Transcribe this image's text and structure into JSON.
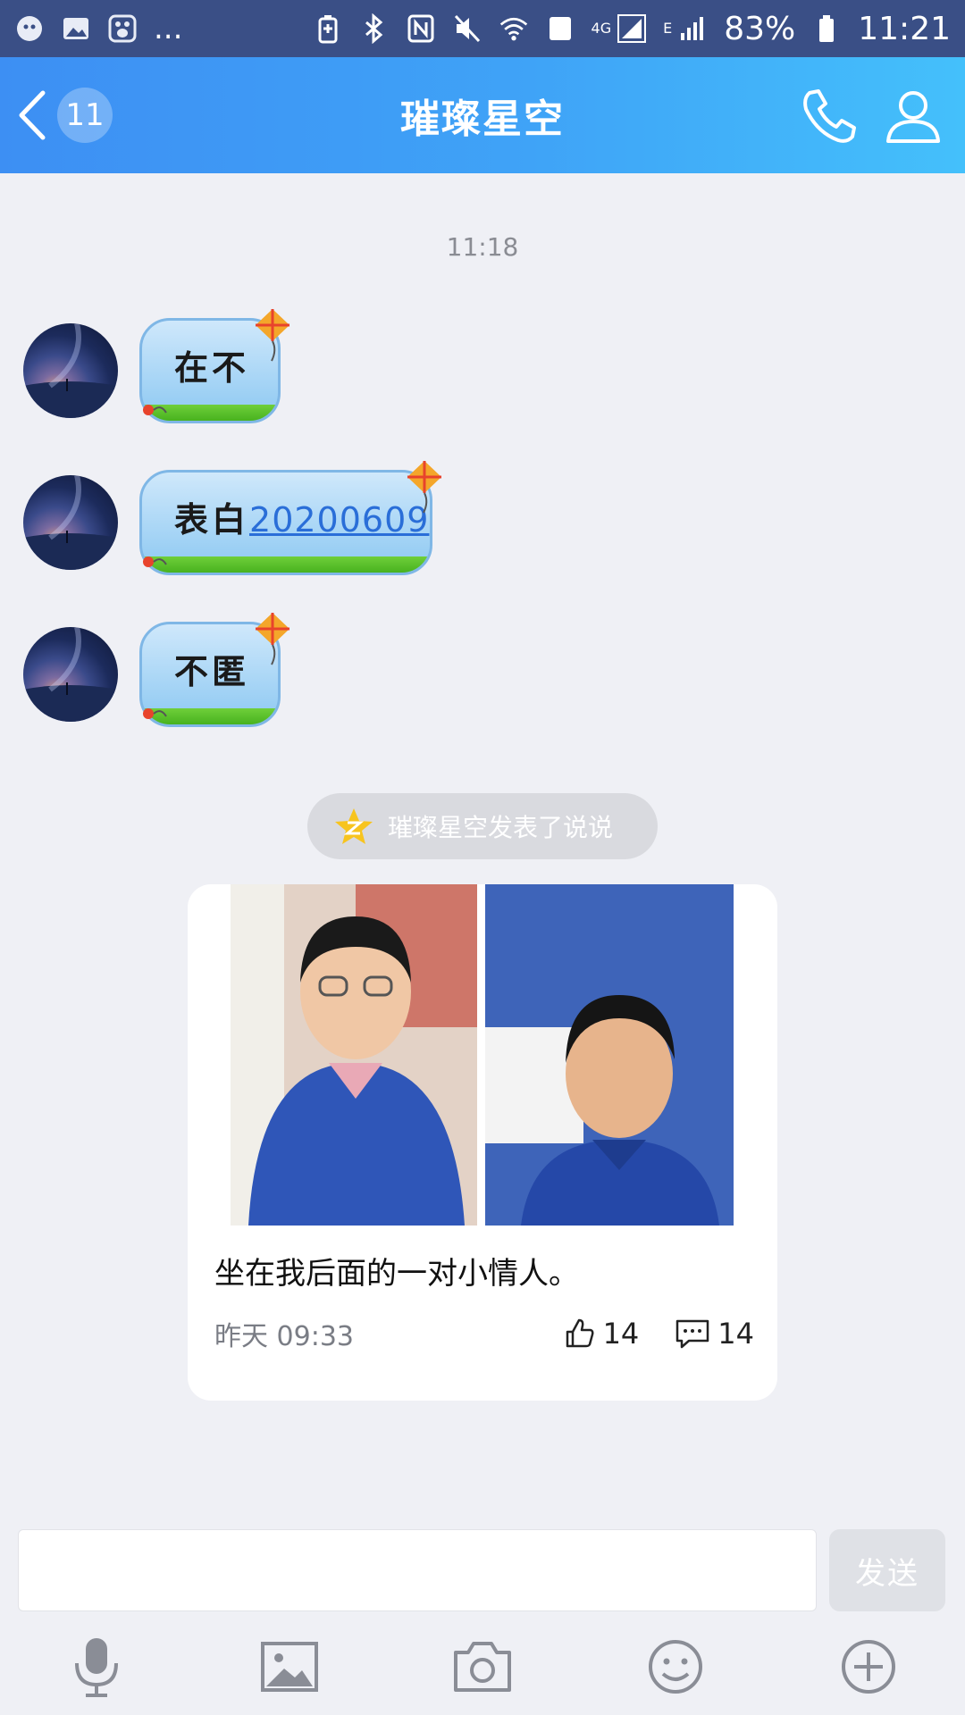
{
  "status_bar": {
    "notification_icons": [
      "cat-app-icon",
      "gallery-icon",
      "baidu-icon"
    ],
    "overflow": "...",
    "sim_badge": "1",
    "network_4g": "4G",
    "network_e": "E",
    "battery": "83%",
    "time": "11:21"
  },
  "header": {
    "back_badge": "11",
    "title": "璀璨星空"
  },
  "chat": {
    "timestamp": "11:18",
    "messages": [
      {
        "text": "在不"
      },
      {
        "prefix": "表白",
        "link": "20200609"
      },
      {
        "text": "不匿"
      }
    ]
  },
  "notice": {
    "text": "璀璨星空发表了说说"
  },
  "post_card": {
    "caption": "坐在我后面的一对小情人。",
    "date": "昨天 09:33",
    "likes": "14",
    "comments": "14"
  },
  "composer": {
    "input_value": "",
    "send_label": "发送"
  },
  "toolbar": {
    "items": [
      "microphone-icon",
      "image-icon",
      "camera-icon",
      "emoji-icon",
      "plus-icon"
    ]
  },
  "colors": {
    "header_start": "#3d8ff3",
    "header_end": "#44c0fb",
    "status_bar": "#3a4f86",
    "background": "#eff0f5",
    "link": "#2a6ed8"
  }
}
